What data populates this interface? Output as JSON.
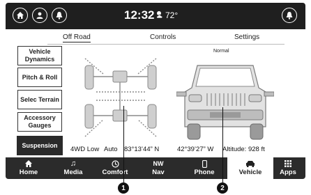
{
  "status_bar": {
    "time": "12:32",
    "temperature": "72°",
    "icons": [
      "home-icon",
      "user-icon",
      "bell-icon",
      "weather-icon",
      "alert-icon"
    ]
  },
  "tabs": [
    {
      "label": "Off Road",
      "active": true
    },
    {
      "label": "Controls",
      "active": false
    },
    {
      "label": "Settings",
      "active": false
    }
  ],
  "side_menu": [
    {
      "label": "Vehicle Dynamics",
      "active": false
    },
    {
      "label": "Pitch & Roll",
      "active": false
    },
    {
      "label": "Selec Terrain",
      "active": false
    },
    {
      "label": "Accessory Gauges",
      "active": false
    },
    {
      "label": "Suspension",
      "active": true
    }
  ],
  "suspension": {
    "height_label": "Normal"
  },
  "info": {
    "mode": "4WD Low",
    "setting": "Auto",
    "latitude": "83°13’44” N",
    "longitude": "42°39’27” W",
    "altitude": "Altitude: 928 ft"
  },
  "nav": [
    {
      "label": "Home",
      "icon": "home-icon",
      "active": false
    },
    {
      "label": "Media",
      "icon": "music-note-icon",
      "active": false
    },
    {
      "label": "Comfort",
      "icon": "comfort-icon",
      "active": false
    },
    {
      "label": "Nav",
      "icon": "compass-icon",
      "glyph": "NW",
      "active": false
    },
    {
      "label": "Phone",
      "icon": "phone-icon",
      "active": false
    },
    {
      "label": "Vehicle",
      "icon": "vehicle-icon",
      "active": true
    },
    {
      "label": "Apps",
      "icon": "apps-grid-icon",
      "active": false
    }
  ],
  "callouts": [
    "1",
    "2"
  ]
}
